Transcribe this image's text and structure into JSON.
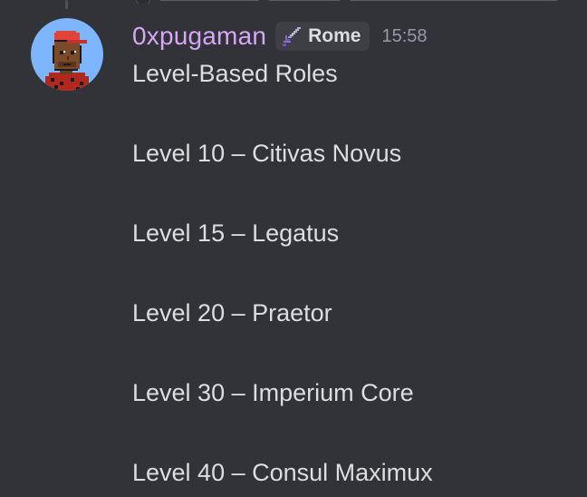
{
  "message": {
    "author": {
      "username": "0xpugaman",
      "username_color": "#d7a6f6",
      "avatar_icon": "pixel-punk-avatar",
      "avatar_bg_color": "#7eb5ff",
      "role_tag": {
        "icon": "pixel-sword-icon",
        "label": "Rome"
      }
    },
    "timestamp": "15:58",
    "lines": [
      "Level-Based Roles",
      "Level 10 – Citivas Novus",
      "Level 15 – Legatus",
      "Level 20 – Praetor",
      "Level 30 – Imperium Core",
      "Level 40 – Consul Maximux"
    ]
  },
  "theme": {
    "background": "#313338",
    "text": "#dbdee1",
    "muted": "#949ba4"
  }
}
